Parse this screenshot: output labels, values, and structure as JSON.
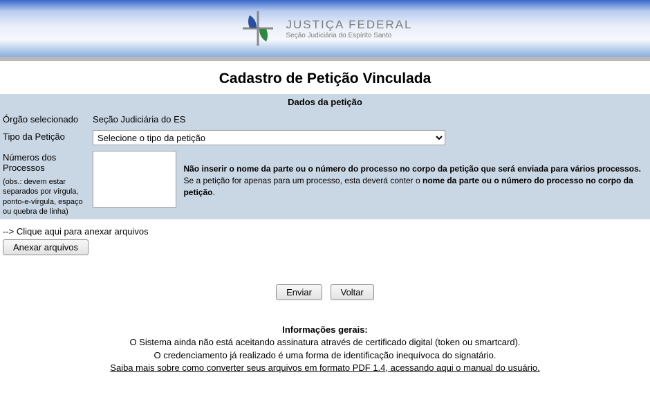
{
  "header": {
    "logo_title": "JUSTIÇA FEDERAL",
    "logo_subtitle": "Seção Judiciária do Espírito Santo"
  },
  "page_title": "Cadastro de Petição Vinculada",
  "form": {
    "section_header": "Dados da petição",
    "orgao": {
      "label": "Órgão selecionado",
      "value": "Seção Judiciária do ES"
    },
    "tipo": {
      "label": "Tipo da Petição",
      "selected": "Selecione o tipo da petição"
    },
    "processos": {
      "label": "Números dos Processos",
      "note": "(obs.: devem estar separados por vírgula, ponto-e-vírgula, espaço ou quebra de linha)",
      "value": "",
      "warn_bold1": "Não inserir o nome da parte ou o número do processo no corpo da petição que será enviada para vários processos.",
      "warn_mid": " Se a petição for apenas para um processo, esta deverá conter o ",
      "warn_bold2": "nome da parte ou o número do processo no corpo da petição",
      "warn_end": "."
    }
  },
  "attach": {
    "hint": "--> Clique aqui para anexar arquivos",
    "button": "Anexar arquivos"
  },
  "actions": {
    "enviar": "Enviar",
    "voltar": "Voltar"
  },
  "info": {
    "heading": "Informações gerais:",
    "line1": "O Sistema ainda não está aceitando assinatura através de certificado digital (token ou smartcard).",
    "line2": "O credenciamento já realizado é uma forma de identificação inequívoca do signatário.",
    "link": "Saiba mais sobre como converter seus arquivos em formato PDF 1.4, acessando aqui o manual do usuário."
  }
}
